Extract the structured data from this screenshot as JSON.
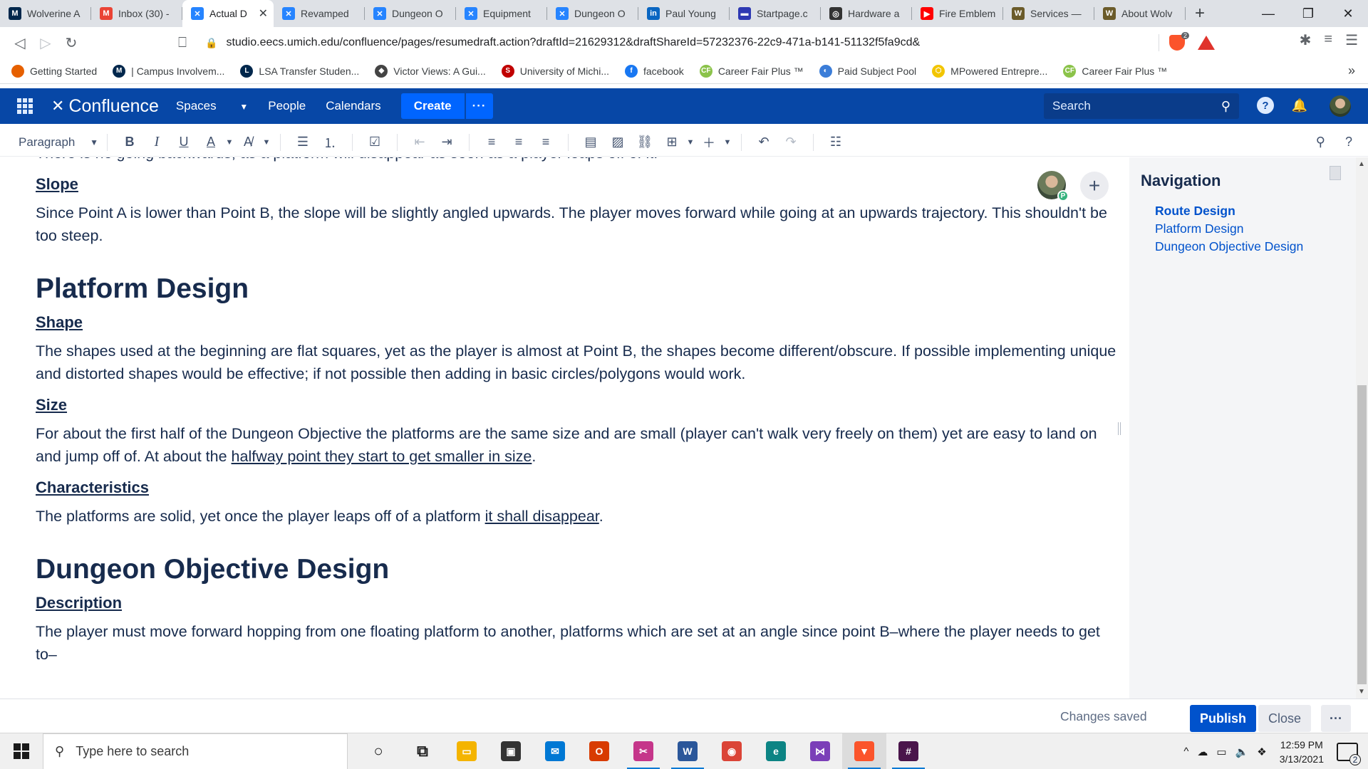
{
  "browser": {
    "tabs": [
      {
        "label": "Wolverine A",
        "icon": "umich-icon",
        "color": "#00274c",
        "glyph": "M",
        "active": false
      },
      {
        "label": "Inbox (30) -",
        "icon": "gmail-icon",
        "color": "#ea4335",
        "glyph": "M",
        "active": false
      },
      {
        "label": "Actual D",
        "icon": "confluence-icon",
        "color": "#2684ff",
        "glyph": "✕",
        "active": true
      },
      {
        "label": "Revamped",
        "icon": "confluence-icon",
        "color": "#2684ff",
        "glyph": "✕",
        "active": false
      },
      {
        "label": "Dungeon O",
        "icon": "confluence-icon",
        "color": "#2684ff",
        "glyph": "✕",
        "active": false
      },
      {
        "label": "Equipment",
        "icon": "confluence-icon",
        "color": "#2684ff",
        "glyph": "✕",
        "active": false
      },
      {
        "label": "Dungeon O",
        "icon": "confluence-icon",
        "color": "#2684ff",
        "glyph": "✕",
        "active": false
      },
      {
        "label": "Paul Young",
        "icon": "linkedin-icon",
        "color": "#0a66c2",
        "glyph": "in",
        "active": false
      },
      {
        "label": "Startpage.c",
        "icon": "startpage-icon",
        "color": "#2e39b3",
        "glyph": "▬",
        "active": false
      },
      {
        "label": "Hardware a",
        "icon": "circle-logo-icon",
        "color": "#333333",
        "glyph": "◎",
        "active": false
      },
      {
        "label": "Fire Emblem",
        "icon": "youtube-icon",
        "color": "#ff0000",
        "glyph": "▶",
        "active": false
      },
      {
        "label": "Services —",
        "icon": "wolverine-icon",
        "color": "#6b5b2a",
        "glyph": "W",
        "active": false
      },
      {
        "label": "About Wolv",
        "icon": "wolverine-icon",
        "color": "#6b5b2a",
        "glyph": "W",
        "active": false
      }
    ],
    "url": "studio.eecs.umich.edu/confluence/pages/resumedraft.action?draftId=21629312&draftShareId=57232376-22c9-471a-b141-51132f5fa9cd&",
    "brave_count": "2",
    "bookmarks": [
      {
        "label": "Getting Started",
        "icon": "firefox-icon",
        "color": "#e66000",
        "glyph": ""
      },
      {
        "label": "| Campus Involvem...",
        "icon": "umich-icon",
        "color": "#00274c",
        "glyph": "M"
      },
      {
        "label": "LSA Transfer Studen...",
        "icon": "lsa-icon",
        "color": "#00274c",
        "glyph": "L"
      },
      {
        "label": "Victor Views: A Gui...",
        "icon": "victor-icon",
        "color": "#444444",
        "glyph": "◆"
      },
      {
        "label": "University of Michi...",
        "icon": "umich-red-icon",
        "color": "#c00000",
        "glyph": "S"
      },
      {
        "label": "facebook",
        "icon": "facebook-icon",
        "color": "#1877f2",
        "glyph": "f"
      },
      {
        "label": "Career Fair Plus ™",
        "icon": "careerfair-icon",
        "color": "#8bc34a",
        "glyph": "CF"
      },
      {
        "label": "Paid Subject Pool",
        "icon": "subjectpool-icon",
        "color": "#3b7dd8",
        "glyph": "◐"
      },
      {
        "label": "MPowered Entrepre...",
        "icon": "mpowered-icon",
        "color": "#f2c500",
        "glyph": "⬡"
      },
      {
        "label": "Career Fair Plus ™",
        "icon": "careerfair-icon",
        "color": "#8bc34a",
        "glyph": "CF"
      }
    ]
  },
  "confluence": {
    "logo_text": "Confluence",
    "nav": {
      "spaces": "Spaces",
      "people": "People",
      "calendars": "Calendars"
    },
    "create_label": "Create",
    "more_label": "···",
    "search_placeholder": "Search",
    "help_glyph": "?",
    "notify_glyph": "🔔"
  },
  "toolbar": {
    "paragraph_label": "Paragraph",
    "bold": "B",
    "italic": "I",
    "underline": "U",
    "text_color": "A",
    "clear_format": "A̸",
    "undo": "↶",
    "redo": "↷"
  },
  "document": {
    "cutoff_line": "There is no going backwards, as a platform will disappear as soon as a player leaps off of it.",
    "slope_heading": "Slope",
    "slope_text": "Since Point A is lower than Point B, the slope will be slightly angled upwards. The player moves forward while going at an upwards trajectory. This shouldn't be too steep.",
    "platform_heading": "Platform Design",
    "shape_heading": "Shape",
    "shape_text": "The shapes used at the beginning are flat squares, yet as the player is almost at Point B, the shapes become different/obscure. If possible implementing unique and distorted shapes would be effective; if not possible then adding in basic circles/polygons would work.",
    "size_heading": "Size",
    "size_text_a": "For about the first half of the Dungeon Objective the platforms are the same size and are small (player can't walk very freely on them) yet are easy to land on and jump off of. At about the ",
    "size_text_link": "halfway point they start to get smaller in size",
    "size_text_b": ".",
    "char_heading": "Characteristics",
    "char_text_a": "The platforms are solid, yet once the player leaps off of a platform ",
    "char_text_link": "it shall disappear",
    "char_text_b": ".",
    "dungeon_heading": "Dungeon Objective Design",
    "desc_heading": "Description",
    "desc_text": "The player must move forward hopping from one floating platform to another, platforms which are set at an angle since point B–where the player needs to get to–",
    "collaborator_badge": "P",
    "add_collaborator": "+"
  },
  "navigation": {
    "title": "Navigation",
    "items": [
      {
        "label": "Route Design",
        "current": true
      },
      {
        "label": "Platform Design",
        "current": false
      },
      {
        "label": "Dungeon Objective Design",
        "current": false
      }
    ]
  },
  "footer": {
    "status": "Changes saved",
    "publish": "Publish",
    "close": "Close",
    "more": "···"
  },
  "taskbar": {
    "search_placeholder": "Type here to search",
    "time": "12:59 PM",
    "date": "3/13/2021",
    "notification_count": "2",
    "apps": [
      {
        "name": "cortana-icon",
        "color": "#f0f0f0",
        "glyph": "○",
        "open": false,
        "active": false
      },
      {
        "name": "task-view-icon",
        "color": "#f0f0f0",
        "glyph": "⧉",
        "open": false,
        "active": false
      },
      {
        "name": "file-explorer-icon",
        "color": "#f4b400",
        "glyph": "▭",
        "open": false,
        "active": false
      },
      {
        "name": "store-icon",
        "color": "#333333",
        "glyph": "▣",
        "open": false,
        "active": false
      },
      {
        "name": "mail-icon",
        "color": "#0078d4",
        "glyph": "✉",
        "open": false,
        "active": false
      },
      {
        "name": "office-icon",
        "color": "#d83b01",
        "glyph": "O",
        "open": false,
        "active": false
      },
      {
        "name": "snip-icon",
        "color": "#c5368a",
        "glyph": "✂",
        "open": true,
        "active": false
      },
      {
        "name": "word-icon",
        "color": "#2b579a",
        "glyph": "W",
        "open": true,
        "active": false
      },
      {
        "name": "chrome-icon",
        "color": "#db4437",
        "glyph": "◉",
        "open": false,
        "active": false
      },
      {
        "name": "edge-icon",
        "color": "#0c8484",
        "glyph": "e",
        "open": false,
        "active": false
      },
      {
        "name": "visual-studio-icon",
        "color": "#7b3fb8",
        "glyph": "⋈",
        "open": false,
        "active": false
      },
      {
        "name": "brave-icon",
        "color": "#fb542b",
        "glyph": "▼",
        "open": true,
        "active": true
      },
      {
        "name": "slack-icon",
        "color": "#4a154b",
        "glyph": "#",
        "open": true,
        "active": false
      }
    ]
  }
}
